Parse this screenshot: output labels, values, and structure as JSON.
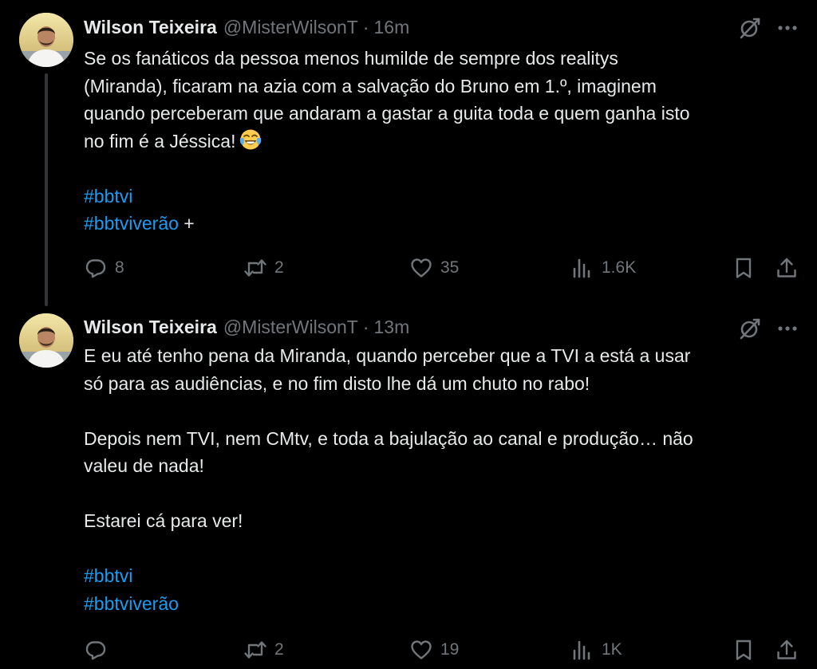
{
  "tweets": [
    {
      "author_name": "Wilson Teixeira",
      "handle": "@MisterWilsonT",
      "separator": "·",
      "time": "16m",
      "body_lines": [
        "Se os fanáticos da pessoa menos humilde de sempre dos realitys",
        "(Miranda), ficaram na azia com a salvação do Bruno em 1.º, imaginem",
        "quando perceberam que andaram a gastar a guita toda e quem ganha isto",
        "no fim é a Jéssica!"
      ],
      "emoji": "face-with-tears-of-joy",
      "hashtags": [
        "#bbtvi",
        "#bbtviverão"
      ],
      "hashtag_suffix": " +",
      "stats": {
        "replies": "8",
        "retweets": "2",
        "likes": "35",
        "views": "1.6K"
      }
    },
    {
      "author_name": "Wilson Teixeira",
      "handle": "@MisterWilsonT",
      "separator": "·",
      "time": "13m",
      "paragraphs": [
        "E eu até tenho pena da Miranda, quando perceber que a TVI a está a usar",
        "só para as audiências, e no fim disto lhe dá um chuto no rabo!",
        "Depois nem TVI, nem CMtv, e toda a bajulação ao canal e produção… não",
        "valeu de nada!",
        "Estarei cá para ver!"
      ],
      "hashtags": [
        "#bbtvi",
        "#bbtviverão"
      ],
      "stats": {
        "replies": "",
        "retweets": "2",
        "likes": "19",
        "views": "1K"
      }
    }
  ],
  "colors": {
    "background": "#000000",
    "text": "#e7e9ea",
    "muted": "#71767b",
    "link": "#1d9bf0",
    "thread_line": "#333639"
  },
  "icons": [
    "grok-icon",
    "more-icon",
    "reply-icon",
    "retweet-icon",
    "like-icon",
    "views-icon",
    "bookmark-icon",
    "share-icon"
  ]
}
